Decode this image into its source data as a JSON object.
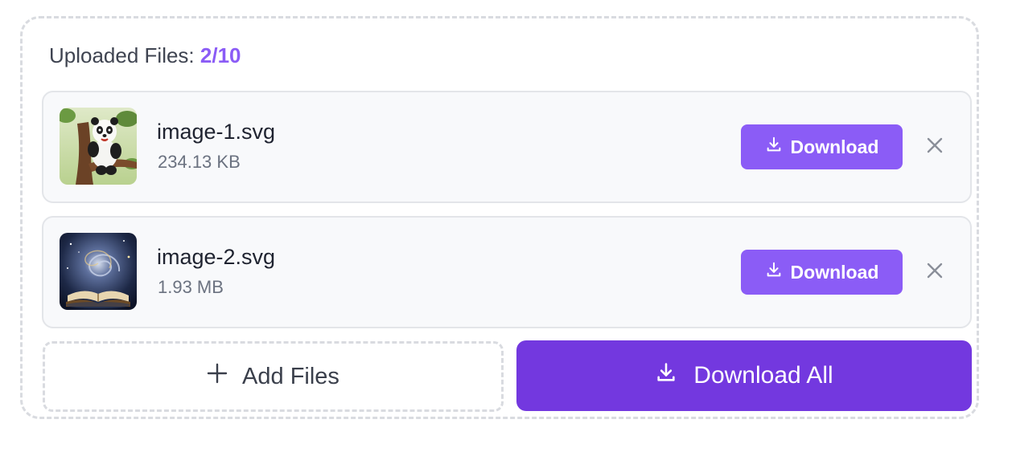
{
  "header": {
    "label": "Uploaded Files:",
    "count": "2/10"
  },
  "files": [
    {
      "name": "image-1.svg",
      "size": "234.13 KB",
      "download_label": "Download",
      "thumbnail": "panda-in-tree"
    },
    {
      "name": "image-2.svg",
      "size": "1.93 MB",
      "download_label": "Download",
      "thumbnail": "galaxy-over-open-book"
    }
  ],
  "actions": {
    "add_files_label": "Add Files",
    "download_all_label": "Download All"
  },
  "icons": {
    "download": "download-icon",
    "remove": "close-icon",
    "add": "plus-icon"
  },
  "colors": {
    "accent": "#8b5cf6",
    "primary_button": "#7338df",
    "border_dashed": "#d9dbe0",
    "card_bg": "#f8f9fb"
  }
}
